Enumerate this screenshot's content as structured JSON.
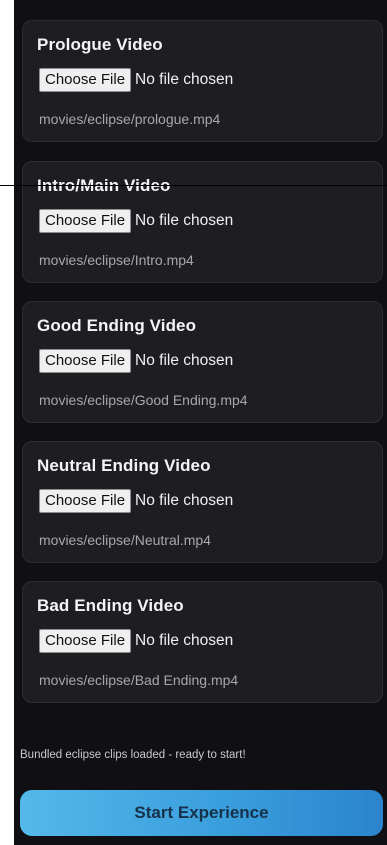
{
  "cards": [
    {
      "title": "Prologue Video",
      "button": "Choose File",
      "status": "No file chosen",
      "path": "movies/eclipse/prologue.mp4"
    },
    {
      "title": "Intro/Main Video",
      "button": "Choose File",
      "status": "No file chosen",
      "path": "movies/eclipse/Intro.mp4"
    },
    {
      "title": "Good Ending Video",
      "button": "Choose File",
      "status": "No file chosen",
      "path": "movies/eclipse/Good Ending.mp4"
    },
    {
      "title": "Neutral Ending Video",
      "button": "Choose File",
      "status": "No file chosen",
      "path": "movies/eclipse/Neutral.mp4"
    },
    {
      "title": "Bad Ending Video",
      "button": "Choose File",
      "status": "No file chosen",
      "path": "movies/eclipse/Bad Ending.mp4"
    }
  ],
  "status_message": "Bundled eclipse clips loaded - ready to start!",
  "start_button": "Start Experience",
  "colors": {
    "background": "#101014",
    "card": "#1d1d22",
    "accent": "#3a9fdd"
  }
}
